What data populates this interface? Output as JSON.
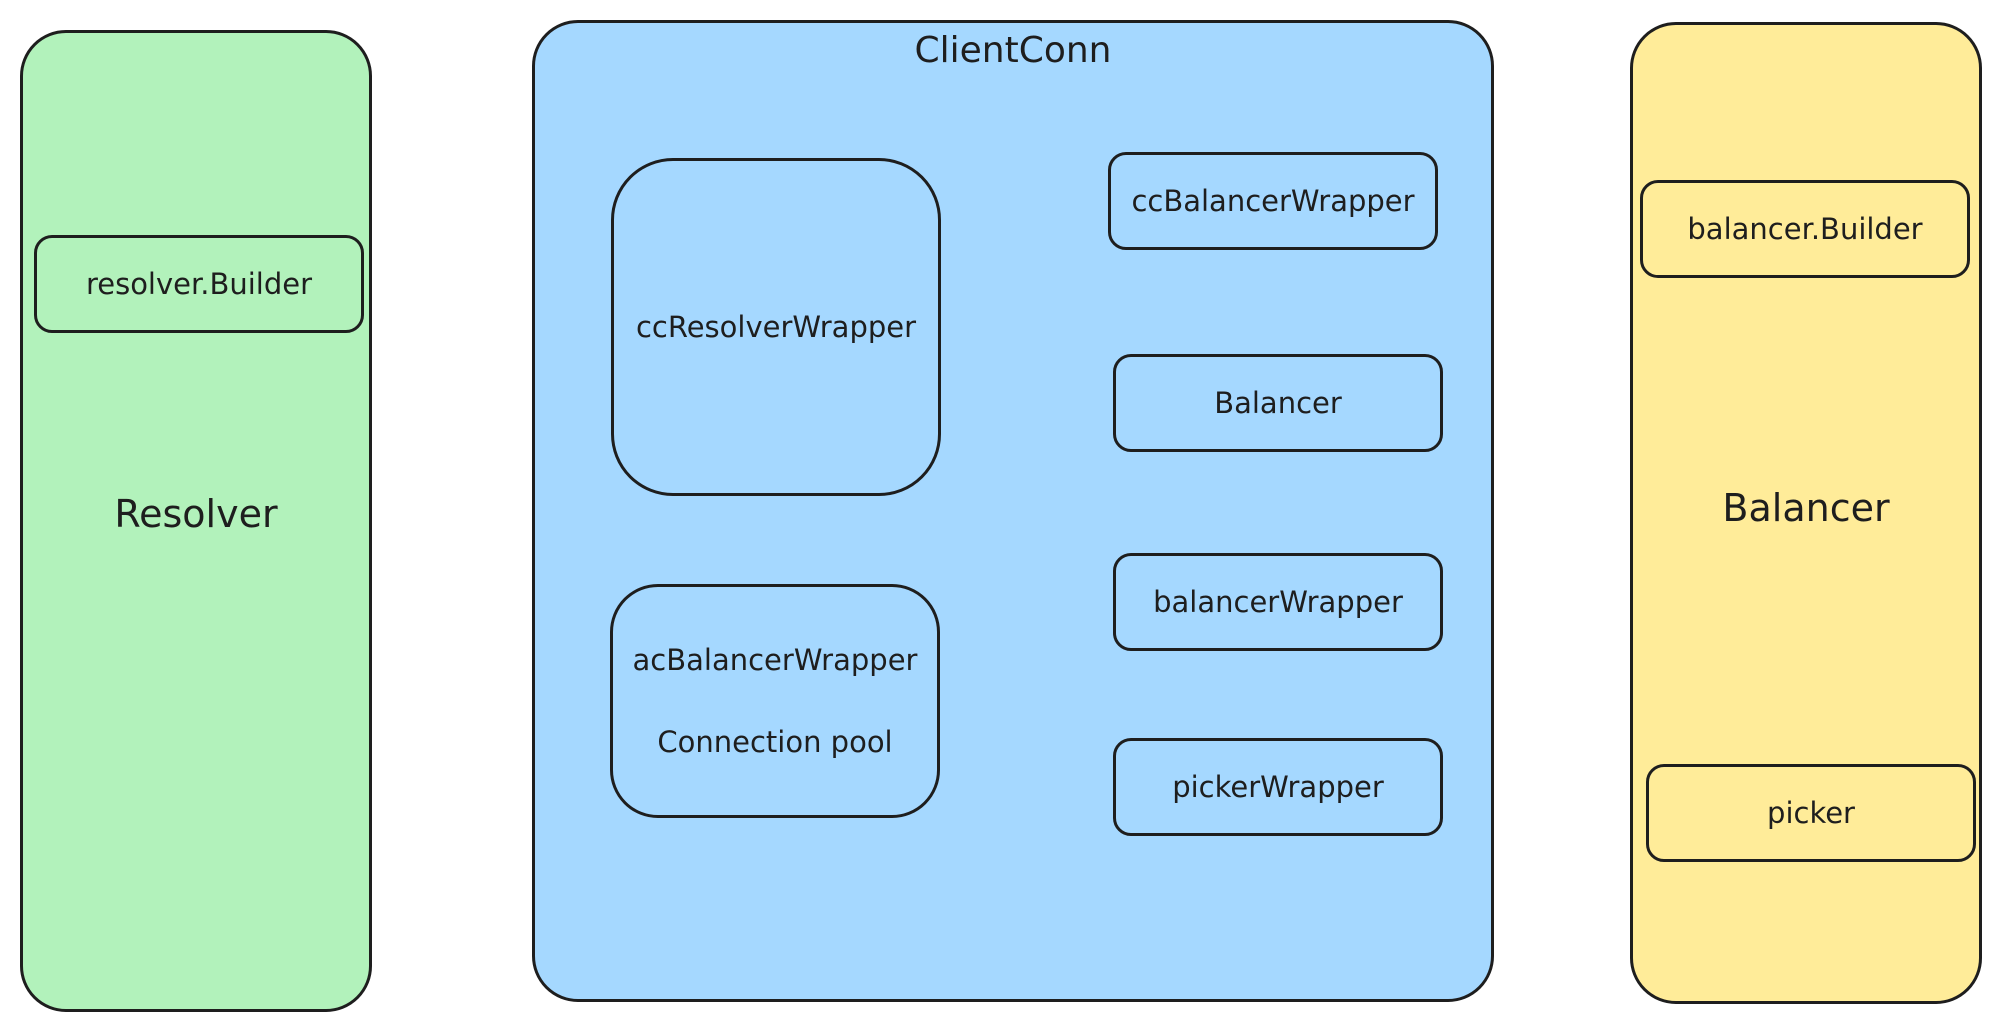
{
  "diagram": {
    "colors": {
      "resolver_fill": "#b2f2bb",
      "clientconn_fill": "#a5d8ff",
      "balancer_fill": "#ffec99",
      "stroke": "#1e1e1e"
    },
    "resolver_panel": {
      "builder_label": "resolver.Builder",
      "panel_label": "Resolver"
    },
    "clientconn_panel": {
      "title": "ClientConn",
      "cc_resolver_wrapper": "ccResolverWrapper",
      "ac_balancer_wrapper": "acBalancerWrapper",
      "connection_pool": "Connection pool",
      "cc_balancer_wrapper": "ccBalancerWrapper",
      "balancer": "Balancer",
      "balancer_wrapper": "balancerWrapper",
      "picker_wrapper": "pickerWrapper"
    },
    "balancer_panel": {
      "builder_label": "balancer.Builder",
      "panel_label": "Balancer",
      "picker_label": "picker"
    }
  }
}
